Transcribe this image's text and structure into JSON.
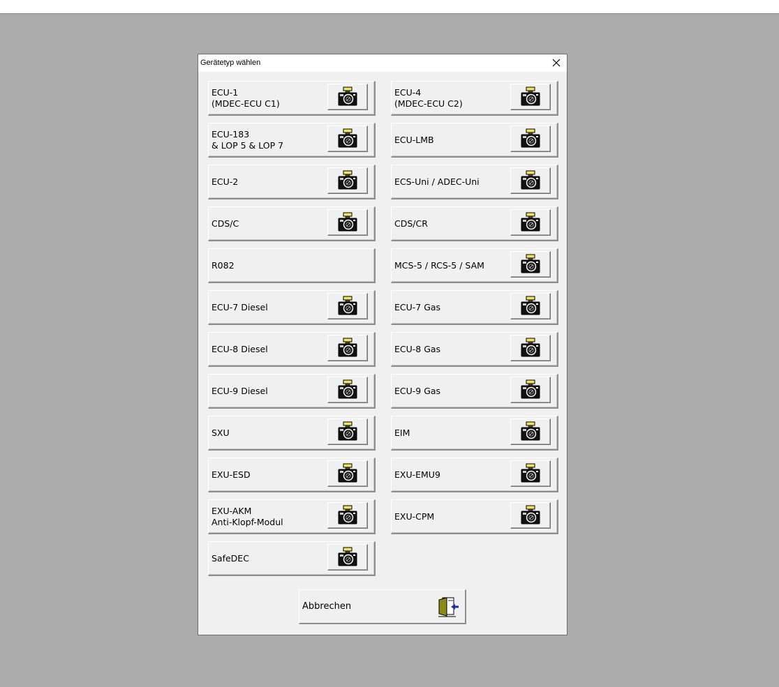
{
  "dialog": {
    "title": "Gerätetyp wählen",
    "close_icon": "close-icon",
    "devices": [
      {
        "label": "ECU-1\n(MDEC-ECU C1)",
        "has_camera": true
      },
      {
        "label": "ECU-4\n(MDEC-ECU C2)",
        "has_camera": true
      },
      {
        "label": "ECU-183\n& LOP 5 & LOP 7",
        "has_camera": true
      },
      {
        "label": "ECU-LMB",
        "has_camera": true
      },
      {
        "label": "ECU-2",
        "has_camera": true
      },
      {
        "label": "ECS-Uni / ADEC-Uni",
        "has_camera": true
      },
      {
        "label": "CDS/C",
        "has_camera": true
      },
      {
        "label": "CDS/CR",
        "has_camera": true
      },
      {
        "label": "R082",
        "has_camera": false
      },
      {
        "label": "MCS-5 / RCS-5 / SAM",
        "has_camera": true
      },
      {
        "label": "ECU-7 Diesel",
        "has_camera": true
      },
      {
        "label": "ECU-7 Gas",
        "has_camera": true
      },
      {
        "label": "ECU-8 Diesel",
        "has_camera": true
      },
      {
        "label": "ECU-8 Gas",
        "has_camera": true
      },
      {
        "label": "ECU-9 Diesel",
        "has_camera": true
      },
      {
        "label": "ECU-9 Gas",
        "has_camera": true
      },
      {
        "label": "SXU",
        "has_camera": true
      },
      {
        "label": "EIM",
        "has_camera": true
      },
      {
        "label": "EXU-ESD",
        "has_camera": true
      },
      {
        "label": "EXU-EMU9",
        "has_camera": true
      },
      {
        "label": "EXU-AKM\nAnti-Klopf-Modul",
        "has_camera": true
      },
      {
        "label": "EXU-CPM",
        "has_camera": true
      },
      {
        "label": "SafeDEC",
        "has_camera": true
      }
    ],
    "camera_icon": "camera-icon",
    "cancel": {
      "label": "Abbrechen",
      "icon": "exit-door-icon"
    }
  },
  "colors": {
    "desktop": "#ababab",
    "dialog_bg": "#f0f0f0",
    "flash": "#f2e35c"
  }
}
